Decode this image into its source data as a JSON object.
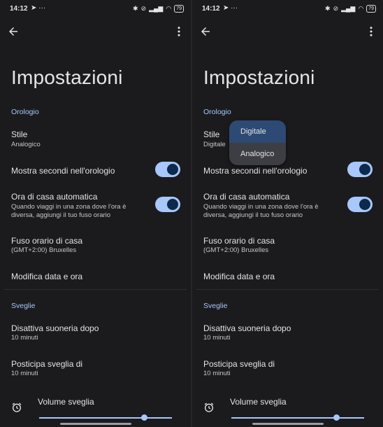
{
  "status": {
    "time": "14:12",
    "battery": "79"
  },
  "page_title": "Impostazioni",
  "sections": {
    "clock": "Orologio",
    "alarms": "Sveglie"
  },
  "style_item": {
    "title": "Stile",
    "value_left": "Analogico",
    "value_right": "Digitale"
  },
  "seconds_item": {
    "title": "Mostra secondi nell'orologio",
    "enabled": true
  },
  "home_time_item": {
    "title": "Ora di casa automatica",
    "subtitle_line1": "Quando viaggi in una zona dove l'ora è",
    "subtitle_line2": "diversa, aggiungi il tuo fuso orario",
    "enabled": true
  },
  "timezone_item": {
    "title": "Fuso orario di casa",
    "value": "(GMT+2:00) Bruxelles"
  },
  "date_time_item": {
    "title": "Modifica data e ora"
  },
  "silence_item": {
    "title": "Disattiva suoneria dopo",
    "value": "10 minuti"
  },
  "snooze_item": {
    "title": "Posticipa sveglia di",
    "value": "10 minuti"
  },
  "volume_item": {
    "title": "Volume sveglia",
    "level": 0.79
  },
  "style_menu": {
    "options": [
      "Digitale",
      "Analogico"
    ],
    "selected": "Digitale"
  },
  "colors": {
    "accent": "#a8c7fa",
    "background": "#1b1b1e"
  }
}
